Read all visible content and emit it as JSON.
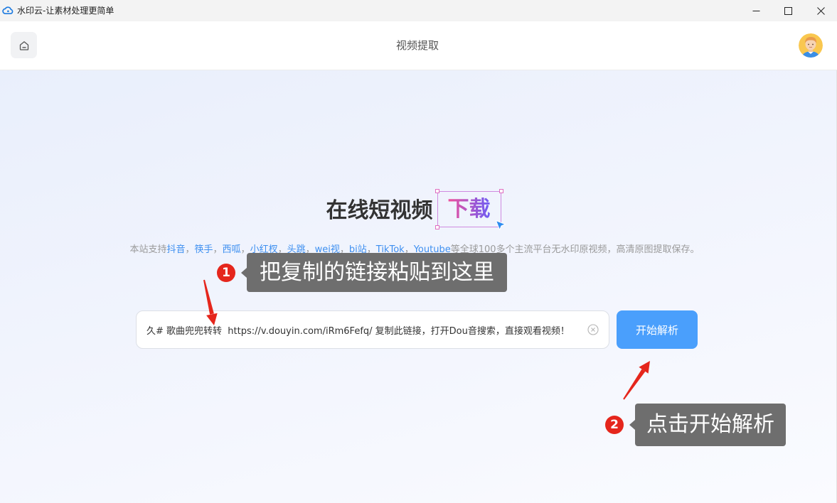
{
  "window": {
    "title": "水印云-让素材处理更简单",
    "icon": "cloud-logo-icon",
    "controls": [
      "minimize-icon",
      "maximize-icon",
      "close-icon"
    ]
  },
  "header": {
    "title": "视频提取",
    "home_icon": "home-icon",
    "avatar": "user-avatar"
  },
  "hero": {
    "title": "在线短视频",
    "highlight": "下载",
    "cursor_icon": "pointer-cursor-icon",
    "subtitle": {
      "prefix": "本站支持",
      "platforms": [
        "抖音",
        "筷手",
        "西呱",
        "小红杈",
        "头跳",
        "wei视",
        "bi站",
        "TikTok",
        "Youtube"
      ],
      "separator": "，",
      "suffix": "等全球100多个主流平台无水印原视频，高清原图提取保存。"
    }
  },
  "link_input": {
    "value": "久# 歌曲兜兜转转  https://v.douyin.com/iRm6Fefq/ 复制此链接，打开Dou音搜索，直接观看视频！",
    "clear_icon": "clear-circle-icon"
  },
  "parse_button": {
    "label": "开始解析"
  },
  "annotations": [
    {
      "number": "1",
      "text": "把复制的链接粘贴到这里",
      "arrow": "red-arrow-down"
    },
    {
      "number": "2",
      "text": "点击开始解析",
      "arrow": "red-arrow-up"
    }
  ],
  "colors": {
    "accent": "#4a9ffc",
    "platform_link": "#3d8ff0",
    "badge_red": "#e5261c",
    "callout_bg": "#6e6e6e",
    "highlight_gradient_start": "#f0519b",
    "highlight_gradient_end": "#6b5cf6",
    "cursor_blue": "#2d8cf0"
  }
}
